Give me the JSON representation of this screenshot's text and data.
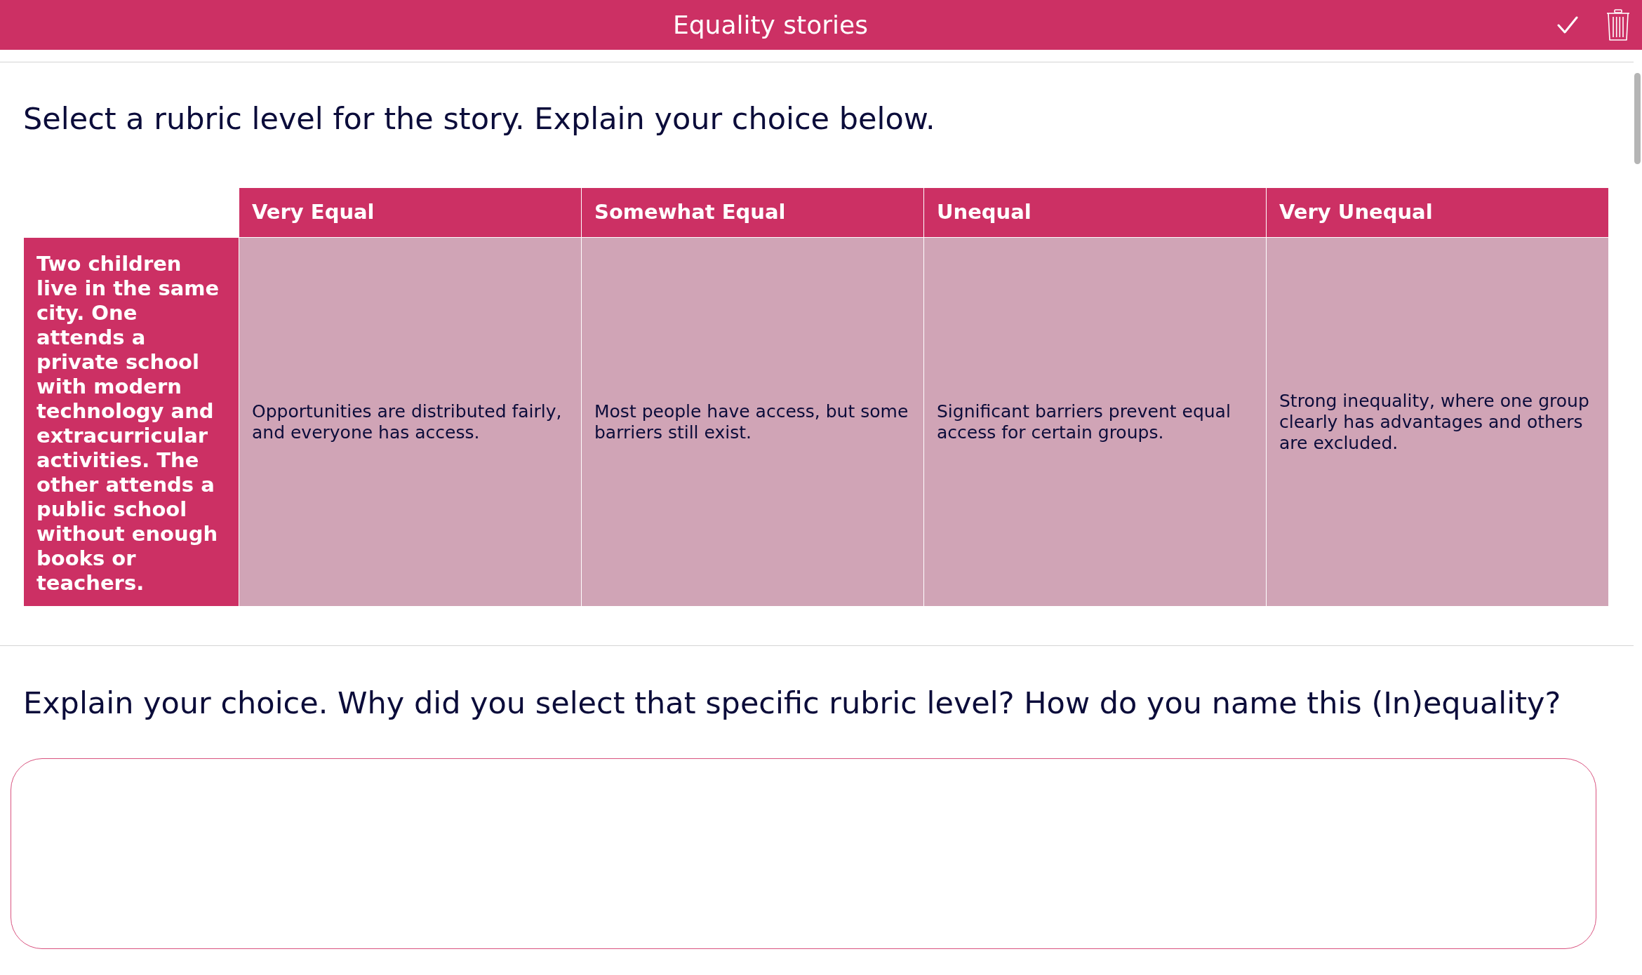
{
  "window": {
    "title": "Equality stories"
  },
  "prompt": "Select a rubric level for the story. Explain your choice below.",
  "rubric": {
    "columns": [
      "Very Equal",
      "Somewhat Equal",
      "Unequal",
      "Very Unequal"
    ],
    "rows": [
      {
        "story": "Two children live in the same city. One attends a private school with modern technology and extracurricular activities. The other attends a public school without enough books or teachers.",
        "cells": [
          {
            "text": "Opportunities are distributed fairly, and everyone has access.",
            "selected": false
          },
          {
            "text": "Most people have access, but some barriers still exist.",
            "selected": false
          },
          {
            "text": "Significant barriers prevent equal access for certain groups.",
            "selected": false
          },
          {
            "text": "Strong inequality, where one group clearly has advantages and others are excluded.",
            "selected": false
          }
        ]
      }
    ]
  },
  "explanation": {
    "question": "Explain your choice. Why did you select that specific rubric level? How do you name this (In)equality?"
  }
}
